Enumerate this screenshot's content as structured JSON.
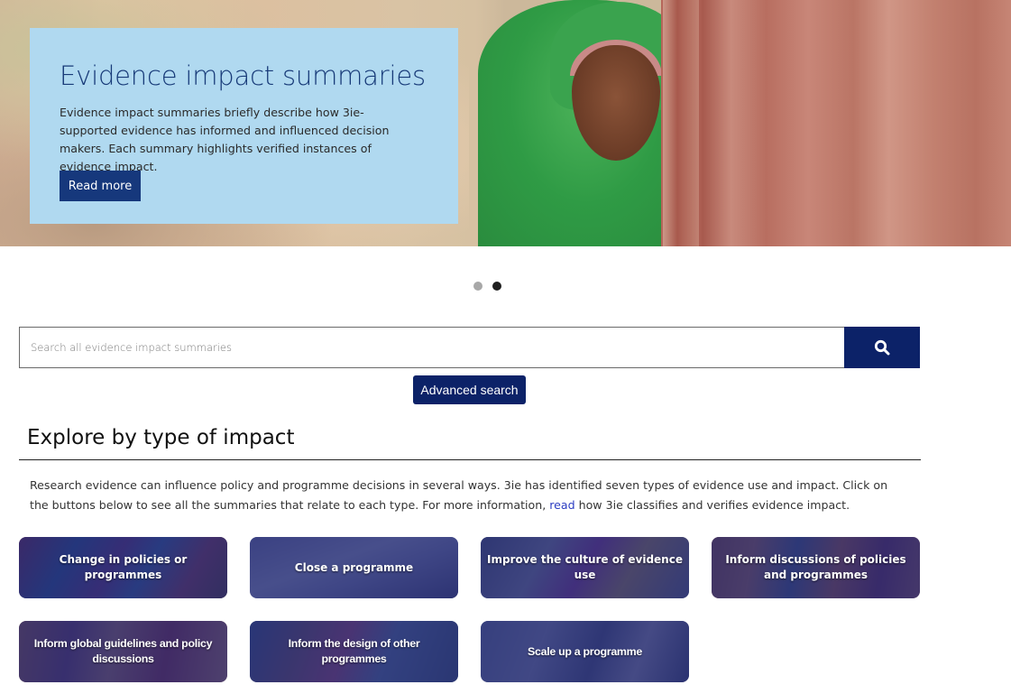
{
  "hero": {
    "title": "Evidence impact summaries",
    "description": "Evidence impact summaries briefly describe how 3ie-supported evidence has informed and influenced decision makers. Each summary highlights verified instances of evidence impact.",
    "button_label": "Read more",
    "image_alt": "Girl in green headscarf leaning against a red wall"
  },
  "carousel": {
    "slide_count": 2,
    "active_index": 1
  },
  "search": {
    "placeholder": "Search all evidence impact summaries",
    "value": "",
    "submit_icon": "search-icon",
    "advanced_label": "Advanced search"
  },
  "explore": {
    "title": "Explore by type of impact",
    "description_before_link": "Research evidence can influence policy and programme decisions in several ways. 3ie has identified seven types of evidence use and impact. Click on the buttons below to see all the summaries that relate to each type. For more information, ",
    "link_text": "read",
    "description_after_link": " how 3ie classifies and verifies evidence impact.",
    "tiles": [
      {
        "label": "Change in policies or programmes"
      },
      {
        "label": "Close a programme"
      },
      {
        "label": "Improve the culture of evidence use"
      },
      {
        "label": "Inform discussions of policies and programmes"
      },
      {
        "label": "Inform global guidelines and policy discussions"
      },
      {
        "label": "Inform the design of other programmes"
      },
      {
        "label": "Scale up a programme"
      }
    ]
  },
  "colors": {
    "brand_navy": "#0c2268",
    "hero_card_bg": "#b0d9f0",
    "hero_title": "#173a78",
    "link": "#2b3cc2"
  }
}
